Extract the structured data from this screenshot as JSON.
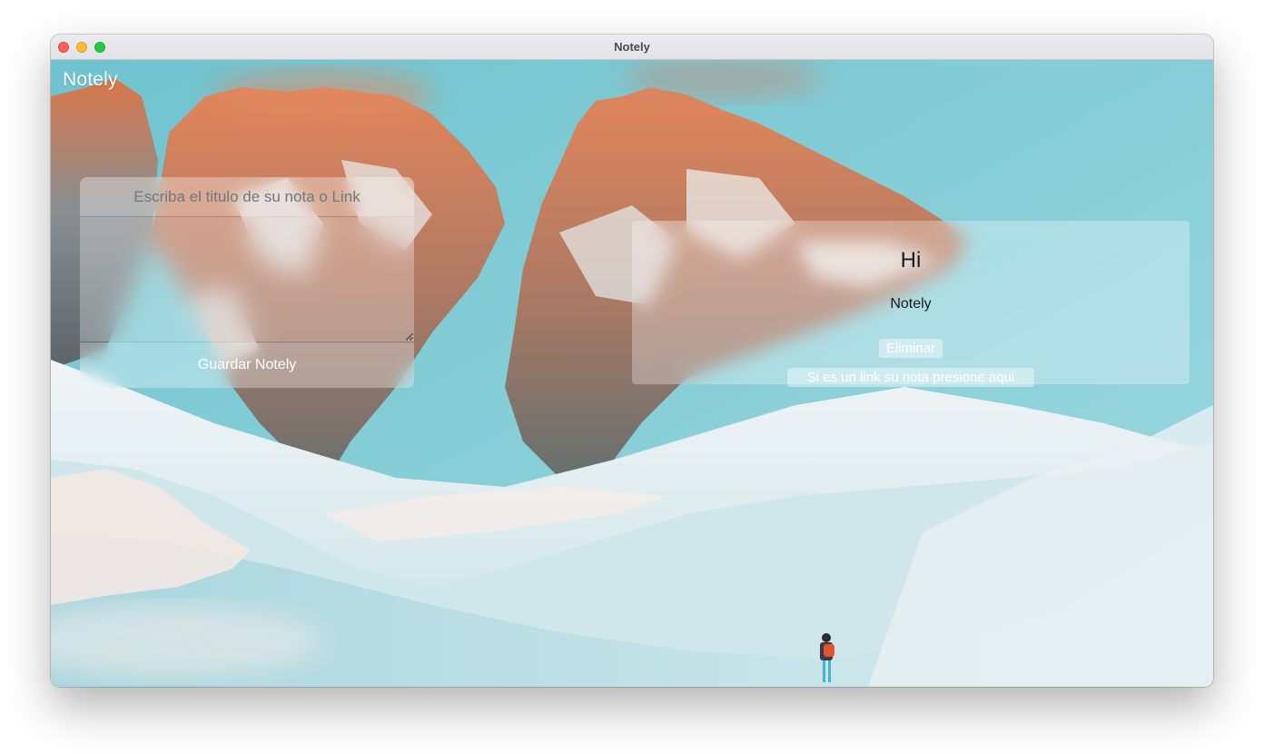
{
  "window": {
    "title": "Notely"
  },
  "app": {
    "brand": "Notely"
  },
  "form": {
    "title_placeholder": "Escriba el titulo de su nota o Link",
    "title_value": "",
    "body_value": "",
    "save_label": "Guardar Notely"
  },
  "notes": [
    {
      "title": "Hi",
      "body": "Notely",
      "delete_label": "Eliminar",
      "link_label": "Si es un link su nota presione aqui"
    }
  ],
  "icons": {
    "close": "window-close-icon",
    "minimize": "window-minimize-icon",
    "maximize": "window-maximize-icon",
    "resize": "resize-grip-icon"
  },
  "colors": {
    "sky": "#86cfd9",
    "close": "#fe5f57",
    "minimize": "#febc2e",
    "maximize": "#28c840",
    "rock": "#c96f47",
    "snow": "#e8f1f3"
  }
}
